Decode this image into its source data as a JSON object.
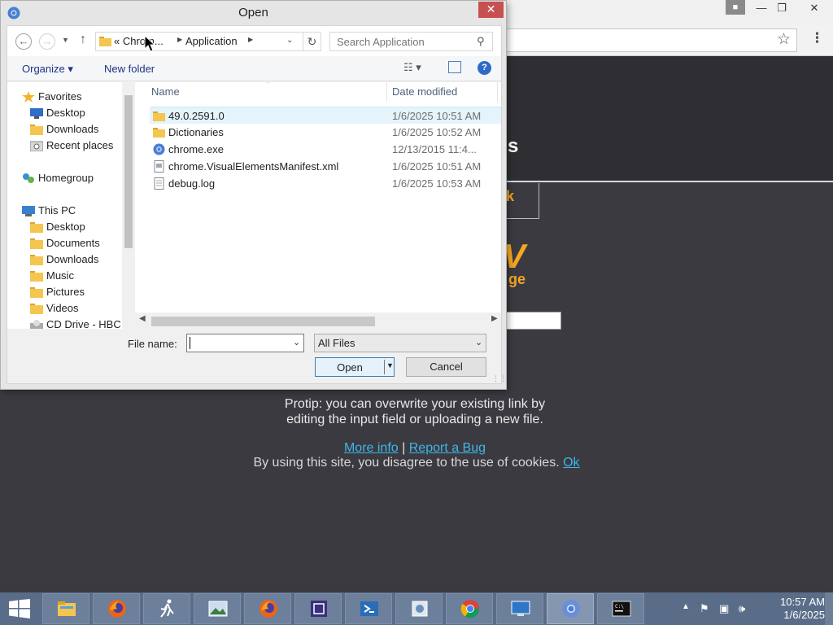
{
  "browser": {
    "page_title_fragment": "s",
    "box_text_fragment": "k",
    "big_letter_fragment": "V",
    "sub_text_fragment": "ge",
    "protip_line1": "Protip: you can overwrite your existing link by",
    "protip_line2": "editing the input field or uploading a new file.",
    "more_info": "More info",
    "separator": "|",
    "report_bug": "Report a Bug",
    "cookies_text": "By using this site, you disagree to the use of cookies.",
    "cookies_ok": "Ok",
    "accent_color": "#f5a623",
    "link_color": "#3fb6e8"
  },
  "dialog": {
    "title": "Open",
    "close_label": "✕",
    "breadcrumb": {
      "prefix": "« Chrom...",
      "current": "Application"
    },
    "search_placeholder": "Search Application",
    "toolbar": {
      "organize": "Organize ▾",
      "new_folder": "New folder"
    },
    "nav_pane": [
      {
        "label": "Favorites",
        "icon": "star-icon"
      },
      {
        "label": "Desktop",
        "icon": "desktop-icon"
      },
      {
        "label": "Downloads",
        "icon": "downloads-icon"
      },
      {
        "label": "Recent places",
        "icon": "recent-places-icon"
      },
      {
        "label": "Homegroup",
        "icon": "homegroup-icon"
      },
      {
        "label": "This PC",
        "icon": "computer-icon"
      },
      {
        "label": "Desktop",
        "icon": "folder-icon"
      },
      {
        "label": "Documents",
        "icon": "folder-icon"
      },
      {
        "label": "Downloads",
        "icon": "folder-icon"
      },
      {
        "label": "Music",
        "icon": "folder-icon"
      },
      {
        "label": "Pictures",
        "icon": "folder-icon"
      },
      {
        "label": "Videos",
        "icon": "folder-icon"
      },
      {
        "label": "CD Drive - HBC",
        "icon": "cd-drive-icon"
      }
    ],
    "columns": {
      "name": "Name",
      "date_modified": "Date modified"
    },
    "files": [
      {
        "name": "49.0.2591.0",
        "date": "1/6/2025 10:51 AM",
        "type_hint": "F",
        "icon": "folder-icon"
      },
      {
        "name": "Dictionaries",
        "date": "1/6/2025 10:52 AM",
        "type_hint": "F",
        "icon": "folder-icon"
      },
      {
        "name": "chrome.exe",
        "date": "12/13/2015 11:4...",
        "type_hint": "A",
        "icon": "chrome-icon"
      },
      {
        "name": "chrome.VisualElementsManifest.xml",
        "date": "1/6/2025 10:51 AM",
        "type_hint": "X",
        "icon": "xml-file-icon"
      },
      {
        "name": "debug.log",
        "date": "1/6/2025 10:53 AM",
        "type_hint": "T",
        "icon": "text-file-icon"
      }
    ],
    "filename_label": "File name:",
    "filename_value": "",
    "filetype_value": "All Files",
    "open_label": "Open",
    "cancel_label": "Cancel"
  },
  "taskbar": {
    "apps": [
      {
        "name": "file-explorer",
        "icon": "file-explorer-icon"
      },
      {
        "name": "firefox",
        "icon": "firefox-icon"
      },
      {
        "name": "runner-app",
        "icon": "running-man-icon"
      },
      {
        "name": "image-viewer",
        "icon": "image-viewer-icon"
      },
      {
        "name": "firefox-2",
        "icon": "firefox-icon"
      },
      {
        "name": "cpu-tool",
        "icon": "cpu-icon"
      },
      {
        "name": "powershell",
        "icon": "powershell-icon"
      },
      {
        "name": "control-tool",
        "icon": "tools-icon"
      },
      {
        "name": "chrome",
        "icon": "chrome-icon"
      },
      {
        "name": "monitor-tool",
        "icon": "monitor-icon"
      },
      {
        "name": "chromium",
        "icon": "chromium-icon"
      },
      {
        "name": "terminal",
        "icon": "terminal-icon"
      }
    ],
    "time": "10:57 AM",
    "date": "1/6/2025"
  }
}
